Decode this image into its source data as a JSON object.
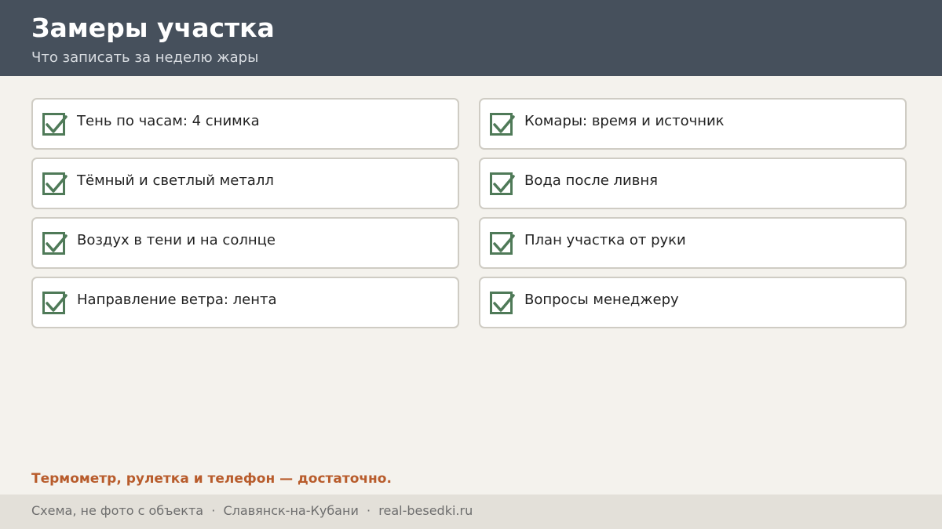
{
  "header": {
    "title": "Замеры участка",
    "subtitle": "Что записать за неделю жары"
  },
  "checklist": {
    "left": [
      {
        "label": "Тень по часам: 4 снимка",
        "checked": true
      },
      {
        "label": "Тёмный и светлый металл",
        "checked": true
      },
      {
        "label": "Воздух в тени и на солнце",
        "checked": true
      },
      {
        "label": "Направление ветра: лента",
        "checked": true
      }
    ],
    "right": [
      {
        "label": "Комары: время и источник",
        "checked": true
      },
      {
        "label": "Вода после ливня",
        "checked": true
      },
      {
        "label": "План участка от руки",
        "checked": true
      },
      {
        "label": "Вопросы менеджеру",
        "checked": true
      }
    ]
  },
  "note": "Термометр, рулетка и телефон — достаточно.",
  "footer": {
    "text": "Схема, не фото с объекта  ·  Славянск-на-Кубани  ·  real-besedki.ru"
  },
  "colors": {
    "header_bg": "#46505c",
    "check": "#4f7a58",
    "accent": "#b85c2c"
  }
}
